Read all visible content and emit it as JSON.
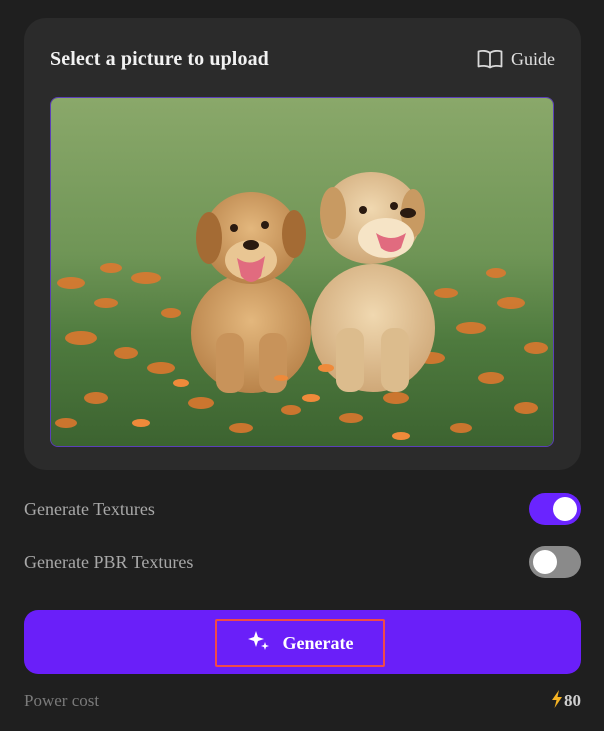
{
  "upload_panel": {
    "title": "Select a picture to upload",
    "guide_label": "Guide",
    "guide_icon": "open-book-icon",
    "image_subject": "two golden retriever puppies sitting on grass with orange flowers"
  },
  "options": [
    {
      "label": "Generate Textures",
      "enabled": true
    },
    {
      "label": "Generate PBR Textures",
      "enabled": false
    }
  ],
  "generate_button": {
    "label": "Generate",
    "icon": "sparkle-icon"
  },
  "footer": {
    "power_label": "Power cost",
    "power_value": "80",
    "power_icon": "lightning-icon"
  },
  "colors": {
    "accent": "#6a1ff9",
    "panel_bg": "#2b2b2b",
    "page_bg": "#1f1f1f",
    "highlight_border": "#f04a4a",
    "lightning": "#f5b323"
  }
}
